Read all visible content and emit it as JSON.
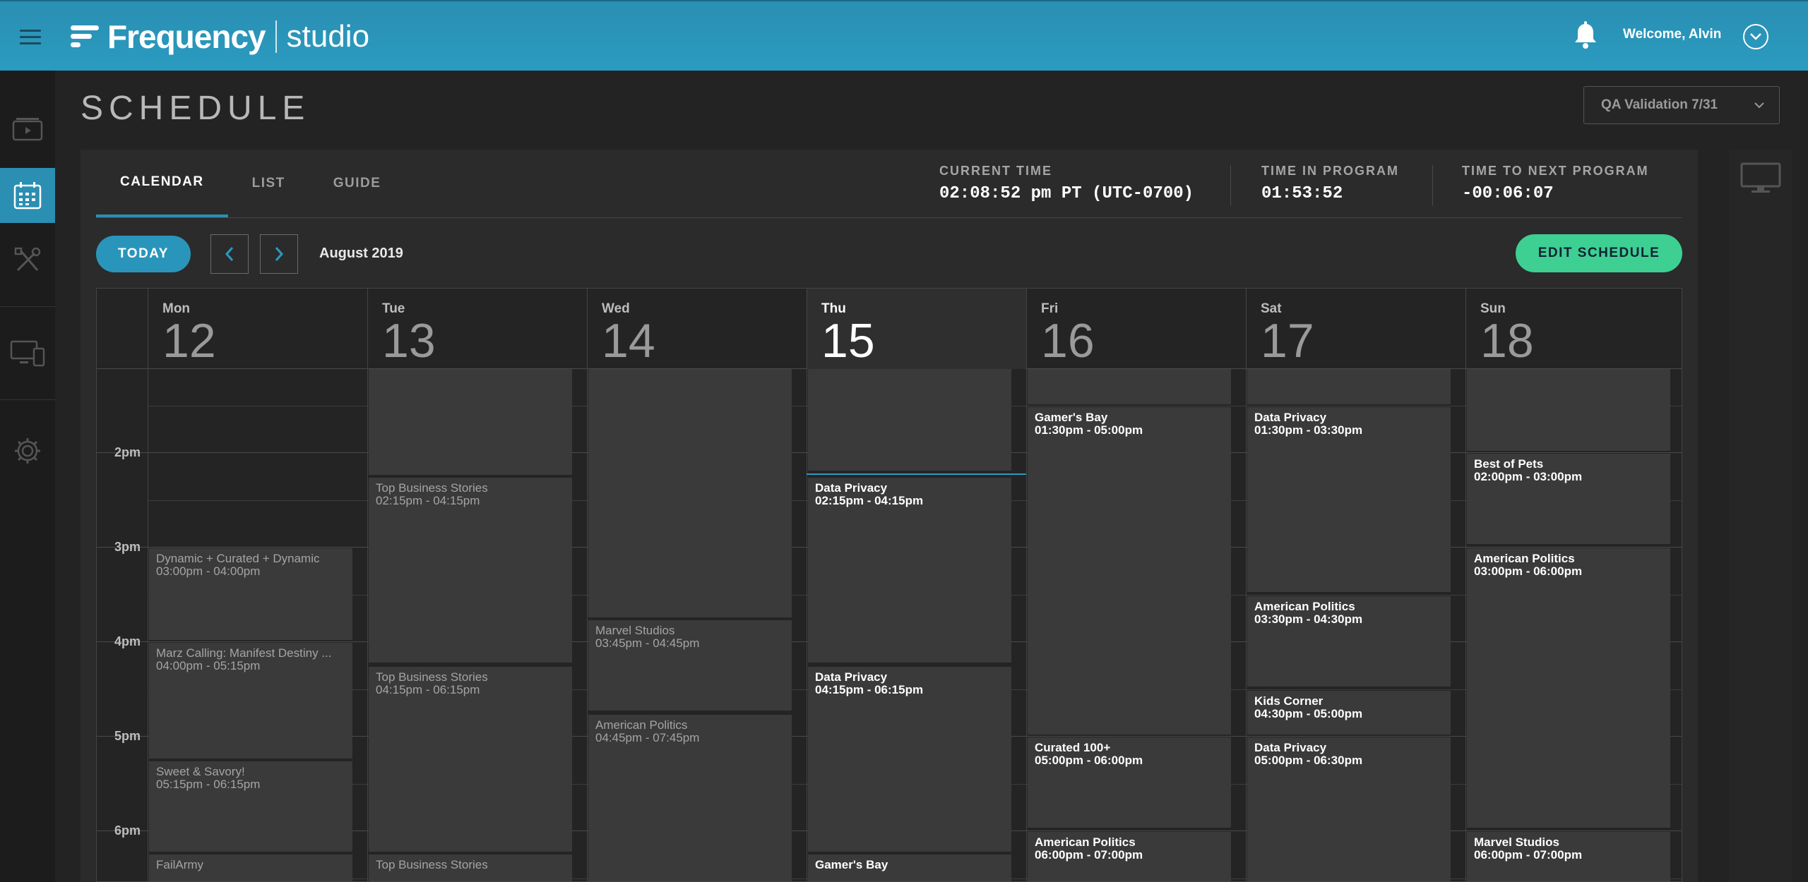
{
  "app": {
    "brand": "Frequency",
    "product": "studio",
    "welcome": "Welcome, Alvin"
  },
  "page": {
    "title": "SCHEDULE",
    "channel_select": "QA Validation 7/31"
  },
  "tabs": [
    {
      "label": "CALENDAR"
    },
    {
      "label": "LIST"
    },
    {
      "label": "GUIDE"
    }
  ],
  "stats": {
    "current_time": {
      "label": "CURRENT TIME",
      "value": "02:08:52 pm PT (UTC-0700)"
    },
    "time_in_program": {
      "label": "TIME IN PROGRAM",
      "value": "01:53:52"
    },
    "time_to_next": {
      "label": "TIME TO NEXT PROGRAM",
      "value": "-00:06:07"
    }
  },
  "toolbar": {
    "today": "TODAY",
    "month": "August 2019",
    "edit": "EDIT SCHEDULE"
  },
  "days": [
    {
      "name": "Mon",
      "num": "12"
    },
    {
      "name": "Tue",
      "num": "13"
    },
    {
      "name": "Wed",
      "num": "14"
    },
    {
      "name": "Thu",
      "num": "15"
    },
    {
      "name": "Fri",
      "num": "16"
    },
    {
      "name": "Sat",
      "num": "17"
    },
    {
      "name": "Sun",
      "num": "18"
    }
  ],
  "time_labels": [
    "2pm",
    "3pm",
    "4pm",
    "5pm",
    "6pm"
  ],
  "events": {
    "mon": [
      {
        "title": "Dynamic + Curated + Dynamic",
        "time": "03:00pm - 04:00pm"
      },
      {
        "title": "Marz Calling: Manifest Destiny ...",
        "time": "04:00pm - 05:15pm"
      },
      {
        "title": "Sweet & Savory!",
        "time": "05:15pm - 06:15pm"
      },
      {
        "title": "FailArmy",
        "time": ""
      }
    ],
    "tue": [
      {
        "title": "Top Business Stories",
        "time": "02:15pm - 04:15pm"
      },
      {
        "title": "Top Business Stories",
        "time": "04:15pm - 06:15pm"
      },
      {
        "title": "Top Business Stories",
        "time": ""
      }
    ],
    "wed": [
      {
        "title": "Marvel Studios",
        "time": "03:45pm - 04:45pm"
      },
      {
        "title": "American Politics",
        "time": "04:45pm - 07:45pm"
      }
    ],
    "thu": [
      {
        "title": "Data Privacy",
        "time": "02:15pm - 04:15pm"
      },
      {
        "title": "Data Privacy",
        "time": "04:15pm - 06:15pm"
      },
      {
        "title": "Gamer's Bay",
        "time": ""
      }
    ],
    "fri": [
      {
        "title": "Gamer's Bay",
        "time": "01:30pm - 05:00pm"
      },
      {
        "title": "Curated 100+",
        "time": "05:00pm - 06:00pm"
      },
      {
        "title": "American Politics",
        "time": "06:00pm - 07:00pm"
      }
    ],
    "sat": [
      {
        "title": "Data Privacy",
        "time": "01:30pm - 03:30pm"
      },
      {
        "title": "American Politics",
        "time": "03:30pm - 04:30pm"
      },
      {
        "title": "Kids Corner",
        "time": "04:30pm - 05:00pm"
      },
      {
        "title": "Data Privacy",
        "time": "05:00pm - 06:30pm"
      }
    ],
    "sun": [
      {
        "title": "Best of Pets",
        "time": "02:00pm - 03:00pm"
      },
      {
        "title": "American Politics",
        "time": "03:00pm - 06:00pm"
      },
      {
        "title": "Marvel Studios",
        "time": "06:00pm - 07:00pm"
      }
    ]
  },
  "colors": {
    "accent": "#2a8fb3",
    "edit_button": "#3ecf93",
    "background": "#232323"
  },
  "icons": [
    "menu-icon",
    "bell-icon",
    "chevron-down-icon",
    "media-icon",
    "calendar-icon",
    "tools-icon",
    "devices-icon",
    "gear-icon",
    "monitor-icon",
    "chevron-left-icon",
    "chevron-right-icon"
  ]
}
